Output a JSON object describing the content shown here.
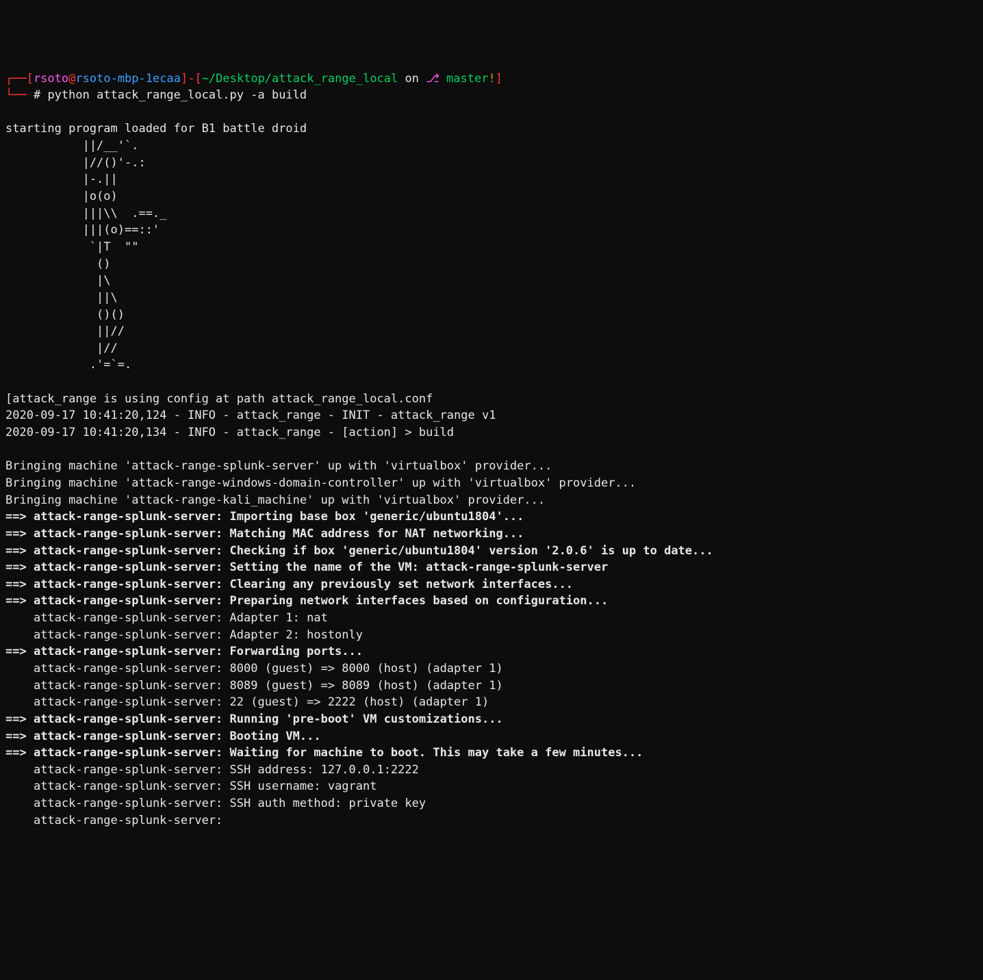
{
  "prompt": {
    "corner_left": "┌──",
    "lb": "[",
    "user": "rsoto",
    "at": "@",
    "host": "rsoto-mbp-1ecaa",
    "rb": "]",
    "sep": "-",
    "lb2": "[",
    "path": "~/Desktop/attack_range_local",
    "on": " on ",
    "branch_icon": "⎇",
    "branch": " master",
    "exc": "!",
    "rb2": "]",
    "corner_bottom": "└──",
    "hash": " # ",
    "command": "python attack_range_local.py -a build"
  },
  "header": "starting program loaded for B1 battle droid",
  "ascii": [
    "           ||/__'`.",
    "           |//()'-.:",
    "           |-.||",
    "           |o(o)",
    "           |||\\\\  .==._",
    "           |||(o)==::'",
    "            `|T  \"\"",
    "             ()",
    "             |\\",
    "             ||\\",
    "             ()()",
    "             ||//",
    "             |//",
    "            .'=`=."
  ],
  "info": [
    "[attack_range is using config at path attack_range_local.conf",
    "2020-09-17 10:41:20,124 - INFO - attack_range - INIT - attack_range v1",
    "2020-09-17 10:41:20,134 - INFO - attack_range - [action] > build"
  ],
  "bringing": [
    "Bringing machine 'attack-range-splunk-server' up with 'virtualbox' provider...",
    "Bringing machine 'attack-range-windows-domain-controller' up with 'virtualbox' provider...",
    "Bringing machine 'attack-range-kali_machine' up with 'virtualbox' provider..."
  ],
  "lines": [
    {
      "arrow": "==> ",
      "bold": "attack-range-splunk-server: Importing base box 'generic/ubuntu1804'..."
    },
    {
      "arrow": "==> ",
      "bold": "attack-range-splunk-server: Matching MAC address for NAT networking..."
    },
    {
      "arrow": "==> ",
      "bold": "attack-range-splunk-server: Checking if box 'generic/ubuntu1804' version '2.0.6' is up to date..."
    },
    {
      "arrow": "==> ",
      "bold": "attack-range-splunk-server: Setting the name of the VM: attack-range-splunk-server"
    },
    {
      "arrow": "==> ",
      "bold": "attack-range-splunk-server: Clearing any previously set network interfaces..."
    },
    {
      "arrow": "==> ",
      "bold": "attack-range-splunk-server: Preparing network interfaces based on configuration..."
    },
    {
      "indent": "    ",
      "text": "attack-range-splunk-server: Adapter 1: nat"
    },
    {
      "indent": "    ",
      "text": "attack-range-splunk-server: Adapter 2: hostonly"
    },
    {
      "arrow": "==> ",
      "bold": "attack-range-splunk-server: Forwarding ports..."
    },
    {
      "indent": "    ",
      "text": "attack-range-splunk-server: 8000 (guest) => 8000 (host) (adapter 1)"
    },
    {
      "indent": "    ",
      "text": "attack-range-splunk-server: 8089 (guest) => 8089 (host) (adapter 1)"
    },
    {
      "indent": "    ",
      "text": "attack-range-splunk-server: 22 (guest) => 2222 (host) (adapter 1)"
    },
    {
      "arrow": "==> ",
      "bold": "attack-range-splunk-server: Running 'pre-boot' VM customizations..."
    },
    {
      "arrow": "==> ",
      "bold": "attack-range-splunk-server: Booting VM..."
    },
    {
      "arrow": "==> ",
      "bold": "attack-range-splunk-server: Waiting for machine to boot. This may take a few minutes..."
    },
    {
      "indent": "    ",
      "text": "attack-range-splunk-server: SSH address: 127.0.0.1:2222"
    },
    {
      "indent": "    ",
      "text": "attack-range-splunk-server: SSH username: vagrant"
    },
    {
      "indent": "    ",
      "text": "attack-range-splunk-server: SSH auth method: private key"
    },
    {
      "indent": "    ",
      "text": "attack-range-splunk-server: "
    }
  ]
}
